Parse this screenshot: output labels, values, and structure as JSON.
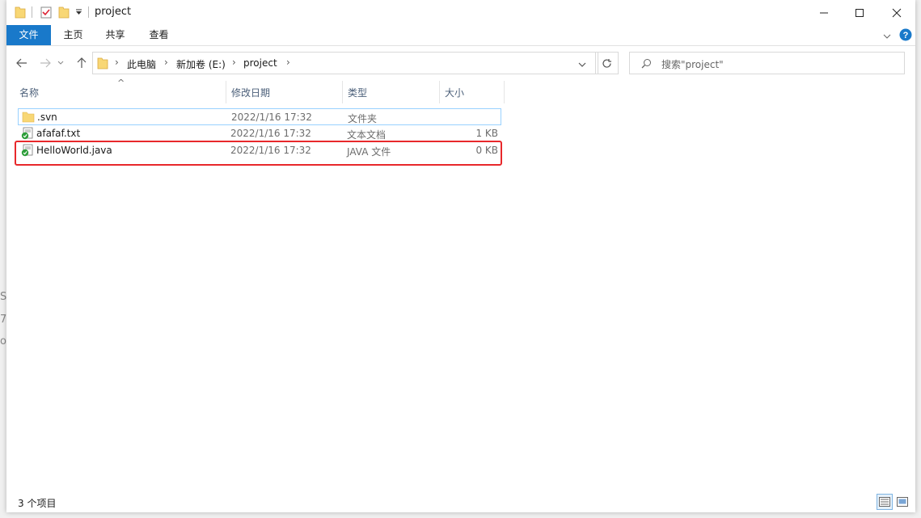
{
  "window": {
    "title": "project",
    "controls": [
      "minimize",
      "maximize",
      "close"
    ]
  },
  "ribbon": {
    "tabs": [
      "文件",
      "主页",
      "共享",
      "查看"
    ]
  },
  "address": {
    "path": [
      "此电脑",
      "新加卷 (E:)",
      "project"
    ]
  },
  "search": {
    "placeholder": "搜索\"project\""
  },
  "columns": {
    "name": "名称",
    "date": "修改日期",
    "type": "类型",
    "size": "大小",
    "sort_indicator": "^"
  },
  "files": [
    {
      "name": ".svn",
      "date": "2022/1/16 17:32",
      "type": "文件夹",
      "size": "",
      "icon": "folder-icon"
    },
    {
      "name": "afafaf.txt",
      "date": "2022/1/16 17:32",
      "type": "文本文档",
      "size": "1 KB",
      "icon": "svn-text-file-icon"
    },
    {
      "name": "HelloWorld.java",
      "date": "2022/1/16 17:32",
      "type": "JAVA 文件",
      "size": "0 KB",
      "icon": "svn-java-file-icon"
    }
  ],
  "status": {
    "item_count": "3 个项目"
  },
  "colors": {
    "accent": "#1979ca",
    "highlight_box": "#e8282b",
    "selection_border": "#99d1ff",
    "folder": "#f8d775"
  }
}
